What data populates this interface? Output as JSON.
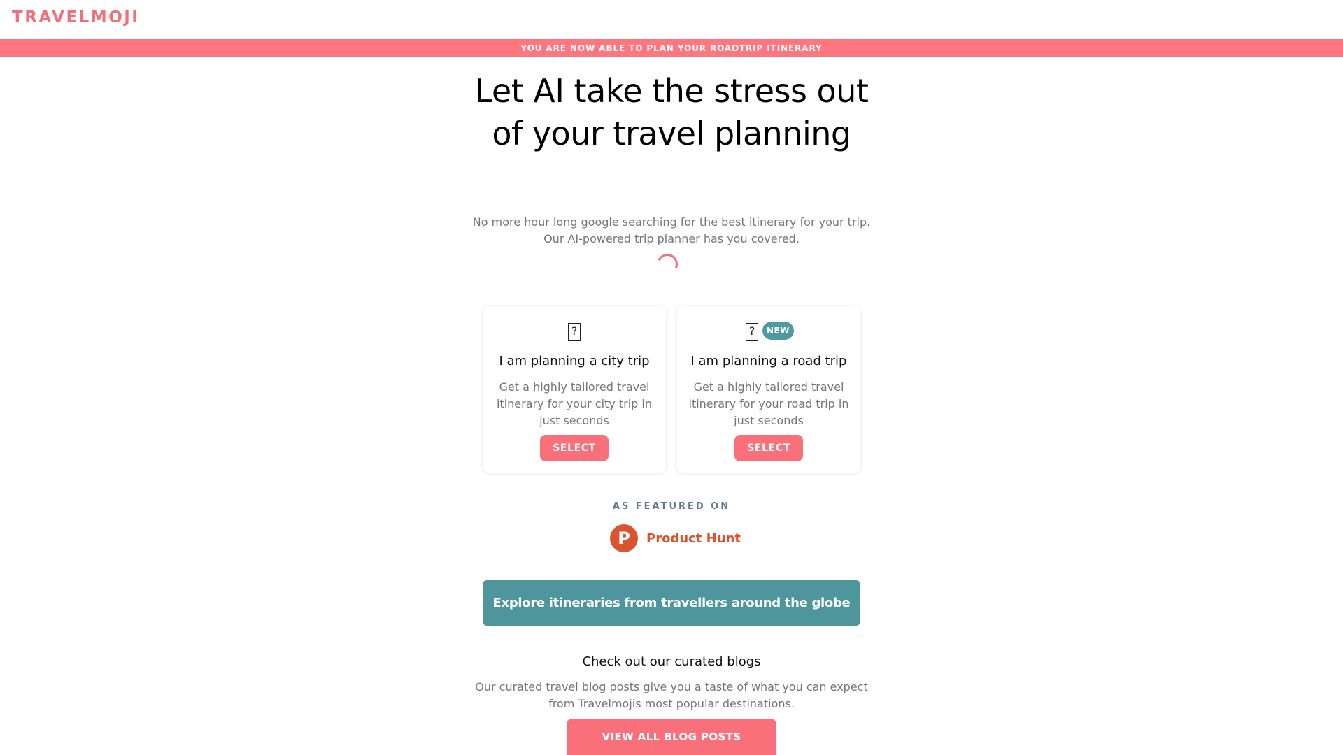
{
  "header": {
    "logo": "TRAVELMOJI"
  },
  "banner": {
    "text": "YOU ARE NOW ABLE TO PLAN YOUR ROADTRIP ITINERARY"
  },
  "hero": {
    "title": "Let AI take the stress out of your travel planning",
    "subtitle_line1": "No more hour long google searching for the best itinerary for your trip.",
    "subtitle_line2": "Our AI-powered trip planner has you covered."
  },
  "cards": [
    {
      "icon": "?",
      "title": "I am planning a city trip",
      "description": "Get a highly tailored travel itinerary for your city trip in just seconds",
      "button": "SELECT"
    },
    {
      "icon": "?",
      "badge": "NEW",
      "title": "I am planning a road trip",
      "description": "Get a highly tailored travel itinerary for your road trip in just seconds",
      "button": "SELECT"
    }
  ],
  "featured": {
    "label": "AS FEATURED ON",
    "logo_letter": "P",
    "name": "Product Hunt"
  },
  "explore": {
    "label": "Explore itineraries from travellers around the globe"
  },
  "blogs": {
    "title": "Check out our curated blogs",
    "desc_line1": "Our curated travel blog posts give you a taste of what you can expect",
    "desc_line2": "from Travelmojis most popular destinations.",
    "button": "VIEW ALL BLOG POSTS"
  },
  "colors": {
    "accent": "#ff767f",
    "teal": "#4e959c",
    "product_hunt": "#da552f"
  }
}
